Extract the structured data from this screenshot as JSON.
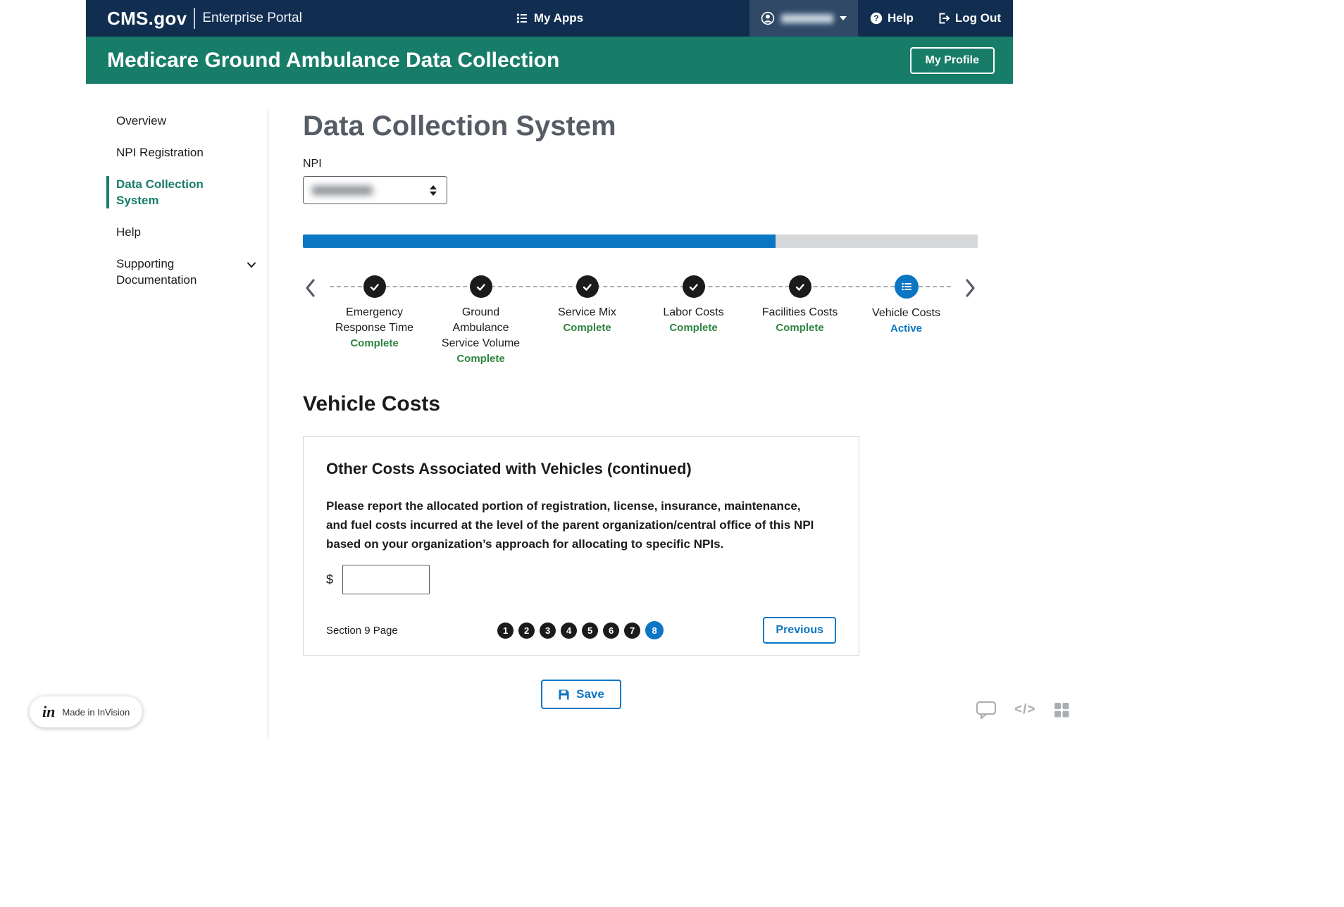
{
  "topbar": {
    "logo": "CMS.gov",
    "logo_sub": "Enterprise Portal",
    "my_apps": "My Apps",
    "help": "Help",
    "log_out": "Log Out"
  },
  "header": {
    "title": "Medicare Ground Ambulance Data Collection",
    "my_profile": "My Profile"
  },
  "sidebar": {
    "items": [
      {
        "label": "Overview",
        "active": false
      },
      {
        "label": "NPI Registration",
        "active": false
      },
      {
        "label": "Data Collection System",
        "active": true
      },
      {
        "label": "Help",
        "active": false
      },
      {
        "label": "Supporting Documentation",
        "active": false,
        "expandable": true
      }
    ]
  },
  "main": {
    "page_title": "Data Collection System",
    "npi_label": "NPI",
    "progress_percent": 70,
    "stepper": [
      {
        "label": "Emergency Response Time",
        "status": "Complete"
      },
      {
        "label": "Ground Ambulance Service Volume",
        "status": "Complete"
      },
      {
        "label": "Service Mix",
        "status": "Complete"
      },
      {
        "label": "Labor Costs",
        "status": "Complete"
      },
      {
        "label": "Facilities Costs",
        "status": "Complete"
      },
      {
        "label": "Vehicle Costs",
        "status": "Active"
      }
    ],
    "section_title": "Vehicle Costs",
    "card": {
      "heading": "Other Costs Associated with Vehicles (continued)",
      "body": "Please report the allocated portion of registration, license, insurance, maintenance, and fuel costs incurred at the level of the parent organization/central office of this NPI based on your organization’s approach for allocating to specific NPIs.",
      "currency_symbol": "$",
      "input_value": "",
      "pagination_label": "Section 9 Page",
      "pages": [
        "1",
        "2",
        "3",
        "4",
        "5",
        "6",
        "7",
        "8"
      ],
      "active_page": "8",
      "previous_label": "Previous"
    },
    "save_label": "Save"
  },
  "footer": {
    "invision_logo": "in",
    "invision_label": "Made in InVision"
  },
  "icons": {
    "code": "</>"
  },
  "colors": {
    "brand_navy": "#112e51",
    "brand_green": "#177d68",
    "accent_blue": "#0b76c4",
    "complete_green": "#2e8540",
    "step_dark": "#1b1b1b"
  }
}
